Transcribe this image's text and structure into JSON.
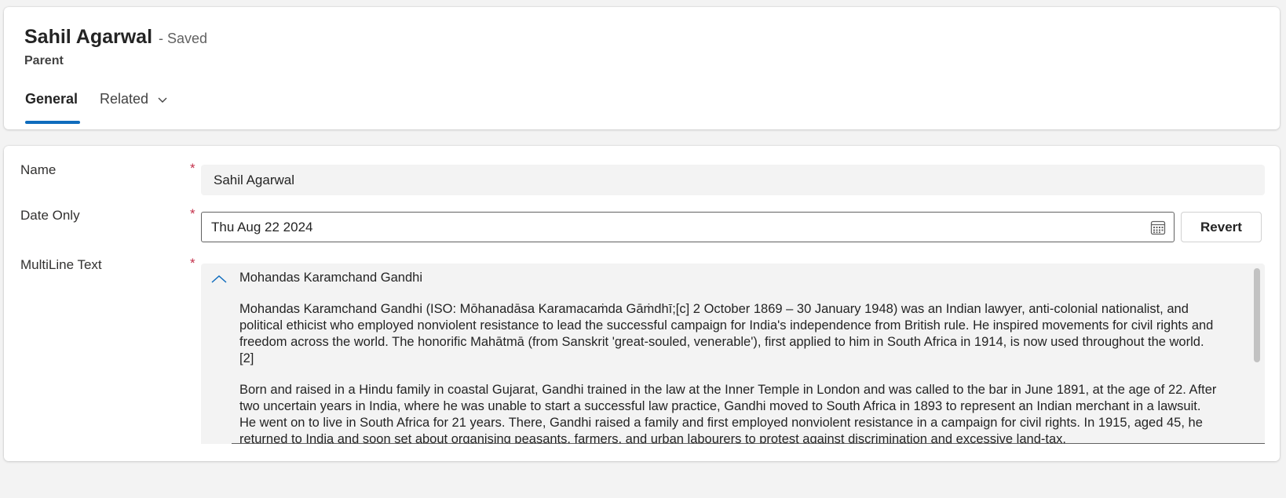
{
  "header": {
    "record_name": "Sahil Agarwal",
    "save_status": "- Saved",
    "entity_name": "Parent",
    "tabs": [
      {
        "label": "General",
        "selected": true
      },
      {
        "label": "Related",
        "has_dropdown": true
      }
    ]
  },
  "form": {
    "fields": {
      "name": {
        "label": "Name",
        "required_marker": "*",
        "value": "Sahil Agarwal"
      },
      "date_only": {
        "label": "Date Only",
        "required_marker": "*",
        "value": "Thu Aug 22 2024",
        "icon": "calendar-icon",
        "revert_label": "Revert"
      },
      "multiline": {
        "label": "MultiLine Text",
        "required_marker": "*",
        "icon": "chevron-up-icon",
        "heading": "Mohandas Karamchand Gandhi",
        "paragraphs": [
          "Mohandas Karamchand Gandhi (ISO: Mōhanadāsa Karamacaṁda Gāṁdhī;[c] 2 October 1869 – 30 January 1948) was an Indian lawyer, anti-colonial nationalist, and political ethicist who employed nonviolent resistance to lead the successful campaign for India's independence from British rule. He inspired movements for civil rights and freedom across the world. The honorific Mahātmā (from Sanskrit 'great-souled, venerable'), first applied to him in South Africa in 1914, is now used throughout the world.[2]",
          "Born and raised in a Hindu family in coastal Gujarat, Gandhi trained in the law at the Inner Temple in London and was called to the bar in June 1891, at the age of 22. After two uncertain years in India, where he was unable to start a successful law practice, Gandhi moved to South Africa in 1893 to represent an Indian merchant in a lawsuit. He went on to live in South Africa for 21 years. There, Gandhi raised a family and first employed nonviolent resistance in a campaign for civil rights. In 1915, aged 45, he returned to India and soon set about organising peasants, farmers, and urban labourers to protest against discrimination and excessive land-tax."
        ]
      }
    }
  },
  "colors": {
    "accent": "#0f6cbd",
    "required": "#c4314b",
    "background": "#f3f3f3"
  }
}
